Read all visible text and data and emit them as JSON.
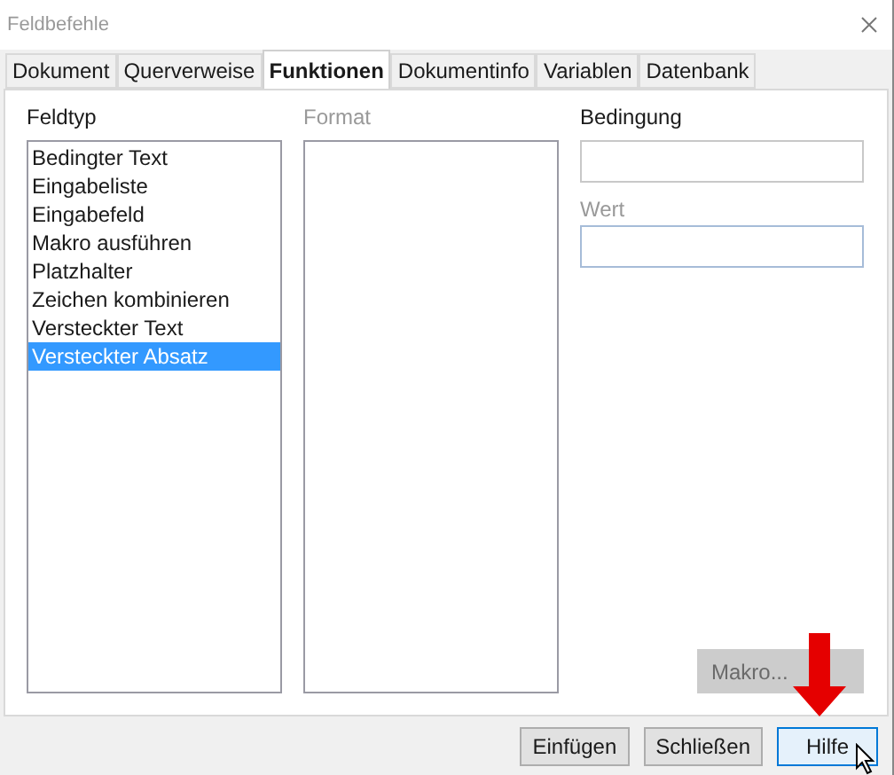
{
  "window": {
    "title": "Feldbefehle"
  },
  "tabs": [
    {
      "label": "Dokument",
      "selected": false
    },
    {
      "label": "Querverweise",
      "selected": false
    },
    {
      "label": "Funktionen",
      "selected": true
    },
    {
      "label": "Dokumentinfo",
      "selected": false
    },
    {
      "label": "Variablen",
      "selected": false
    },
    {
      "label": "Datenbank",
      "selected": false
    }
  ],
  "feldtyp": {
    "label": "Feldtyp",
    "items": [
      {
        "label": "Bedingter Text",
        "selected": false
      },
      {
        "label": "Eingabeliste",
        "selected": false
      },
      {
        "label": "Eingabefeld",
        "selected": false
      },
      {
        "label": "Makro ausführen",
        "selected": false
      },
      {
        "label": "Platzhalter",
        "selected": false
      },
      {
        "label": "Zeichen kombinieren",
        "selected": false
      },
      {
        "label": "Versteckter Text",
        "selected": false
      },
      {
        "label": "Versteckter Absatz",
        "selected": true
      }
    ]
  },
  "format": {
    "label": "Format",
    "disabled": true
  },
  "bedingung": {
    "label": "Bedingung"
  },
  "wert": {
    "label": "Wert",
    "disabled": true,
    "focused": true
  },
  "makro_button": {
    "label": "Makro...",
    "disabled": true
  },
  "buttons": [
    {
      "label": "Einfügen",
      "focused": false
    },
    {
      "label": "Schließen",
      "focused": false
    },
    {
      "label": "Hilfe",
      "focused": true
    }
  ]
}
